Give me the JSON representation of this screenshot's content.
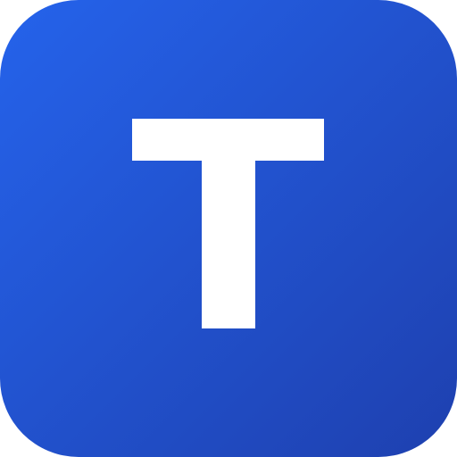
{
  "app_icon": {
    "letter": "T",
    "glyph_color": "#ffffff",
    "gradient_start": "#2563eb",
    "gradient_end": "#1e40af"
  }
}
